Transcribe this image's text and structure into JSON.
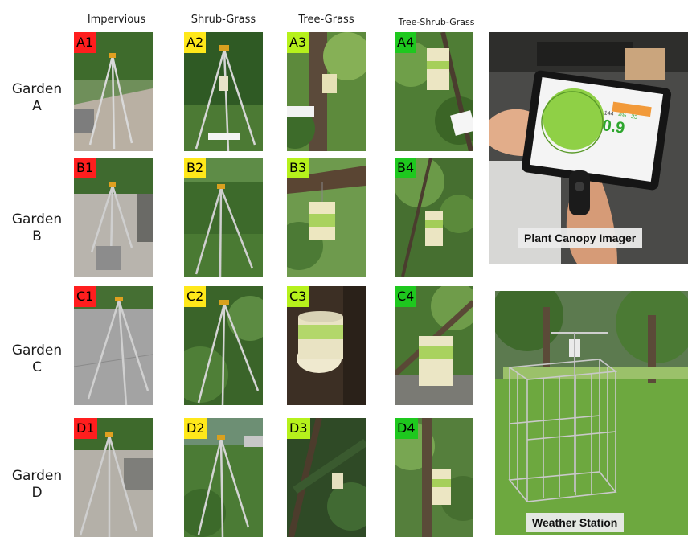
{
  "columns": [
    "Impervious",
    "Shrub-Grass",
    "Tree-Grass",
    "Tree-Shrub-Grass"
  ],
  "rows": [
    {
      "line1": "Garden",
      "line2": "A"
    },
    {
      "line1": "Garden",
      "line2": "B"
    },
    {
      "line1": "Garden",
      "line2": "C"
    },
    {
      "line1": "Garden",
      "line2": "D"
    }
  ],
  "tags": [
    [
      "A1",
      "A2",
      "A3",
      "A4"
    ],
    [
      "B1",
      "B2",
      "B3",
      "B4"
    ],
    [
      "C1",
      "C2",
      "C3",
      "C4"
    ],
    [
      "D1",
      "D2",
      "D3",
      "D4"
    ]
  ],
  "tag_colors": {
    "Impervious": "#ff1e1e",
    "Shrub-Grass": "#ffe81a",
    "Tree-Grass": "#b6f11c",
    "Tree-Shrub-Grass": "#1ec81e"
  },
  "device_readout": {
    "big_value": "0.9",
    "small_values": [
      "144",
      "4%",
      "23"
    ]
  },
  "captions": {
    "imager": "Plant Canopy Imager",
    "station": "Weather Station"
  }
}
